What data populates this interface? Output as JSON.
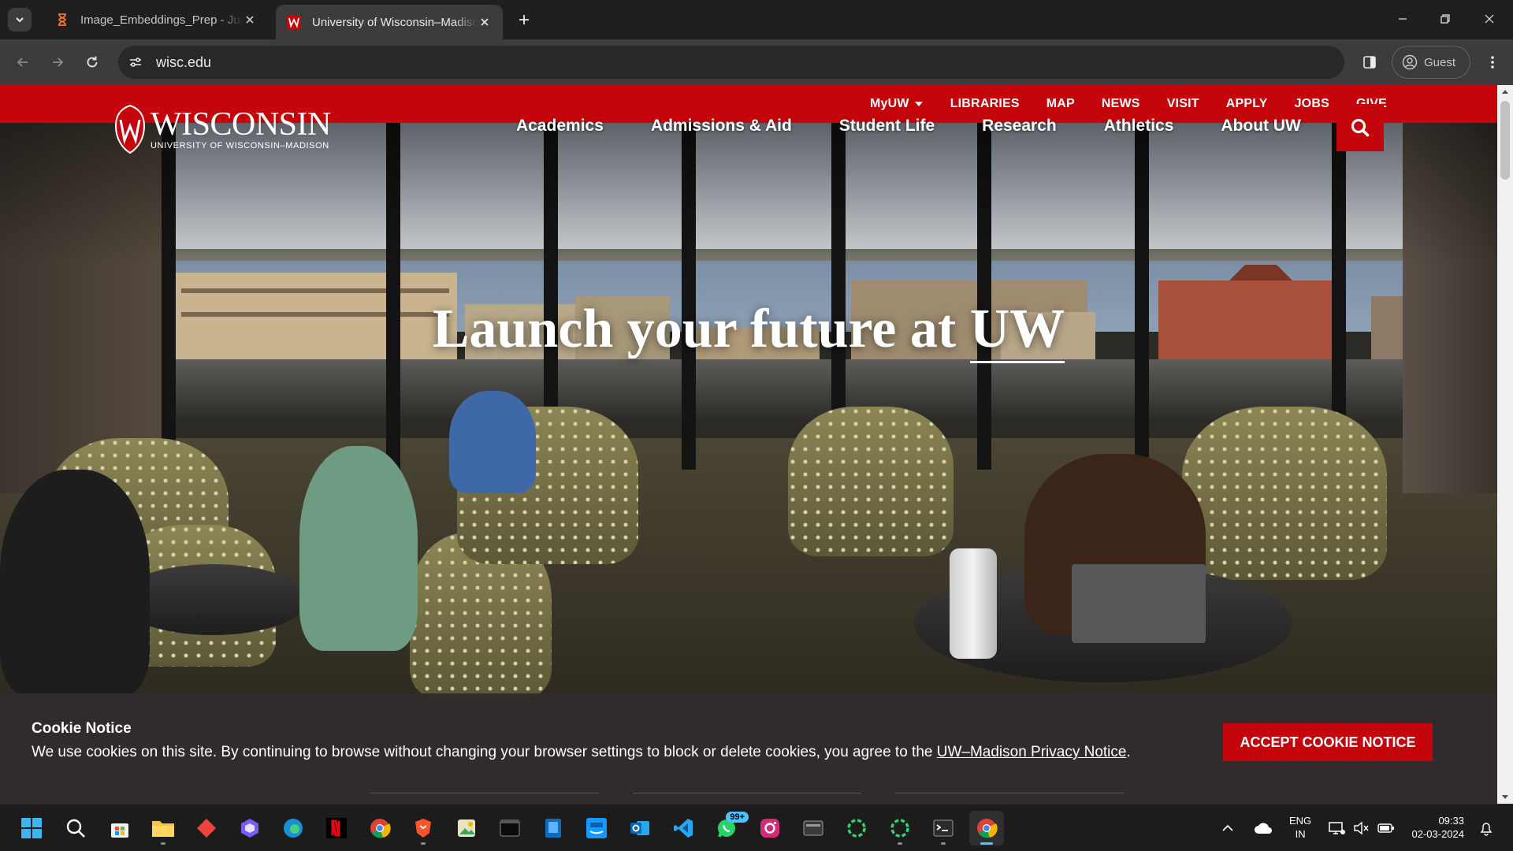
{
  "browser": {
    "tabs": [
      {
        "title": "Image_Embeddings_Prep - Jupyter",
        "favicon": "hourglass-icon",
        "active": false
      },
      {
        "title": "University of Wisconsin–Madison",
        "favicon": "uw-w-icon",
        "active": true
      }
    ],
    "address": "wisc.edu",
    "profile_label": "Guest"
  },
  "site": {
    "utility_links": [
      "MyUW",
      "LIBRARIES",
      "MAP",
      "NEWS",
      "VISIT",
      "APPLY",
      "JOBS",
      "GIVE"
    ],
    "logo": {
      "wordmark": "WISCONSIN",
      "subtitle": "UNIVERSITY OF WISCONSIN–MADISON"
    },
    "main_nav": [
      "Academics",
      "Admissions & Aid",
      "Student Life",
      "Research",
      "Athletics",
      "About UW"
    ],
    "hero": {
      "headline_prefix": "Launch your future at ",
      "headline_emphasis": "UW"
    },
    "cookie": {
      "title": "Cookie Notice",
      "text": "We use cookies on this site. By continuing to browse without changing your browser settings to block or delete cookies, you agree to the ",
      "link": "UW–Madison Privacy Notice",
      "suffix": ".",
      "button": "ACCEPT COOKIE NOTICE"
    },
    "colors": {
      "brand_red": "#c5050c"
    }
  },
  "taskbar": {
    "apps": [
      "start-icon",
      "search-icon",
      "microsoft-store-icon",
      "file-explorer-icon",
      "anydesk-icon",
      "copilot-icon",
      "edge-icon",
      "netflix-icon",
      "chrome-icon",
      "brave-icon",
      "photos-icon",
      "terminal-icon",
      "blue-app-icon",
      "prime-video-icon",
      "outlook-icon",
      "vscode-icon",
      "whatsapp-icon",
      "instagram-icon",
      "window-icon",
      "spinner-green-icon",
      "spinner-green-2-icon",
      "console-icon",
      "chrome-active-icon"
    ],
    "whatsapp_badge": "99+",
    "lang_line1": "ENG",
    "lang_line2": "IN",
    "time": "09:33",
    "date": "02-03-2024"
  }
}
